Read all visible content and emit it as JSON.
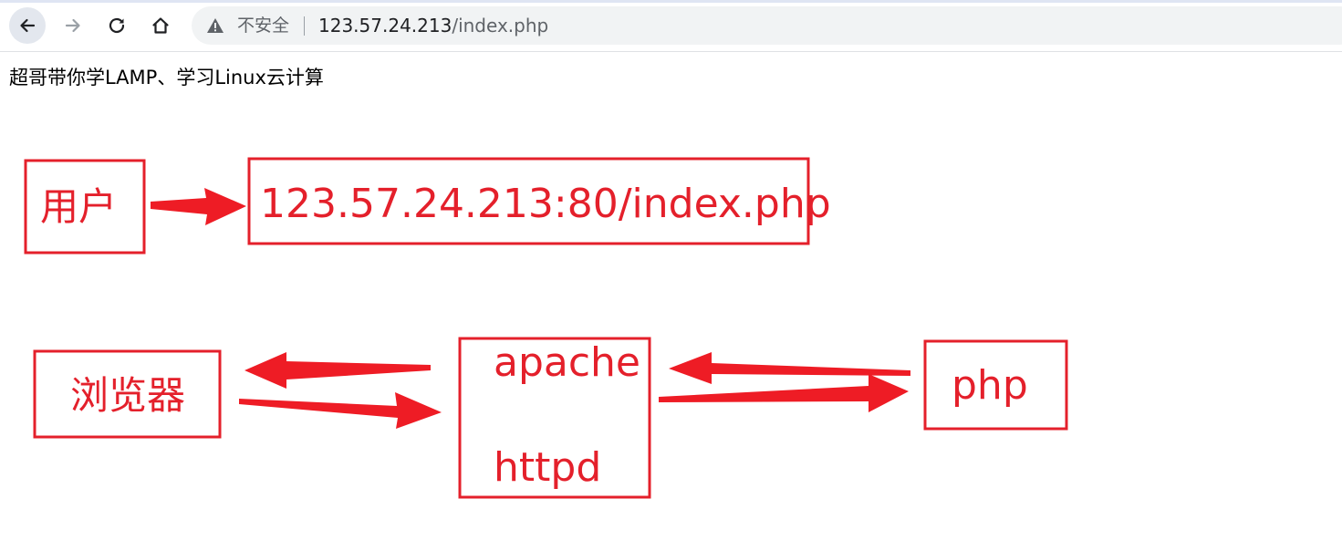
{
  "browser": {
    "security_label": "不安全",
    "url_host": "123.57.24.213",
    "url_path": "/index.php"
  },
  "page": {
    "heading": "超哥带你学LAMP、学习Linux云计算"
  },
  "diagram": {
    "user_label": "用户",
    "request_url_label": "123.57.24.213:80/index.php",
    "browser_label": "浏览器",
    "apache_label": "apache",
    "httpd_label": "httpd",
    "php_label": "php",
    "accent_color": "#e4202b"
  }
}
